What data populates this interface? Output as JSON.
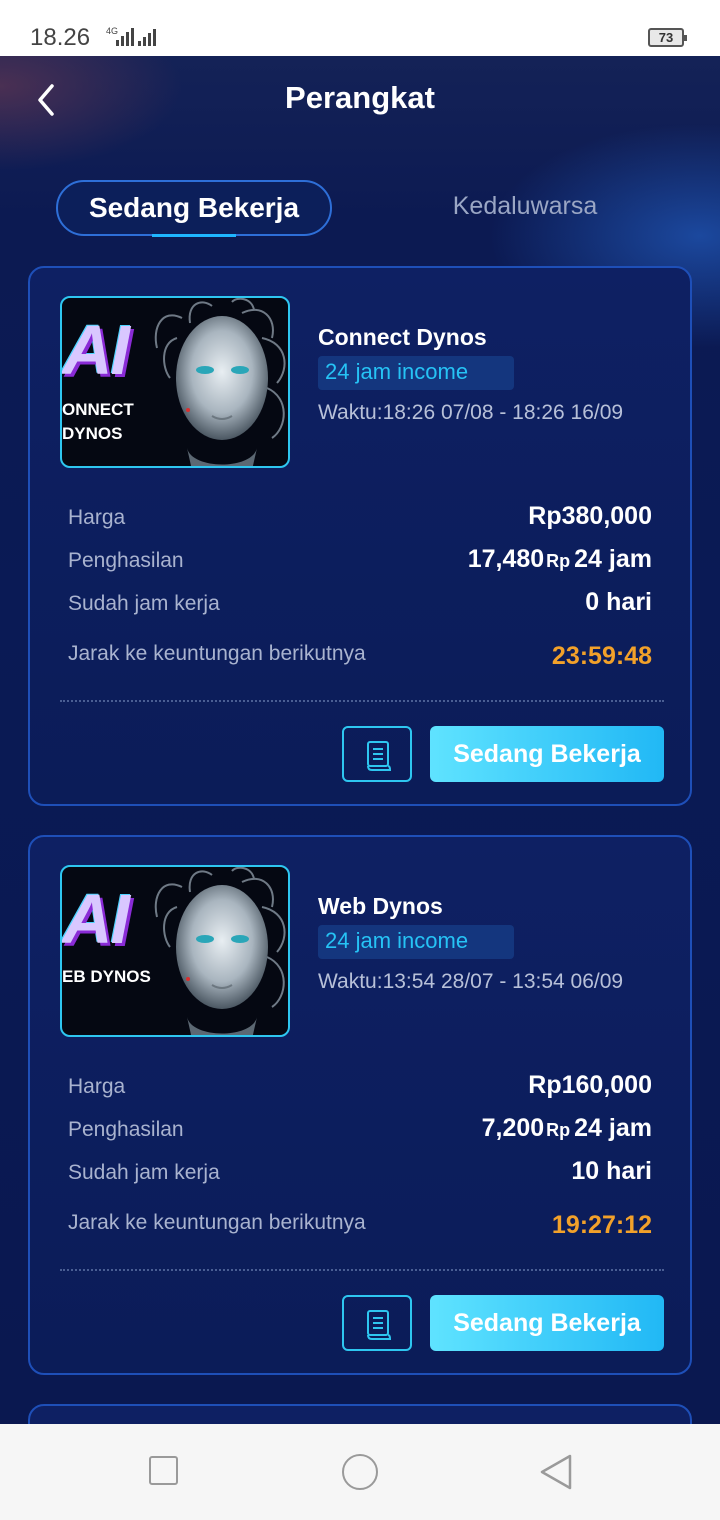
{
  "status_bar": {
    "time": "18.26",
    "network": "4G",
    "battery": "73"
  },
  "header": {
    "title": "Perangkat"
  },
  "tabs": {
    "active": "Sedang Bekerja",
    "inactive": "Kedaluwarsa"
  },
  "labels": {
    "price": "Harga",
    "income": "Penghasilan",
    "worked": "Sudah jam kerja",
    "next_profit": "Jarak ke keuntungan berikutnya",
    "currency_small": "Rp",
    "period": "24 jam",
    "days_unit": "hari"
  },
  "cards": [
    {
      "thumb_text": "AI",
      "thumb_label_line1": "ONNECT",
      "thumb_label_line2": "DYNOS",
      "name": "Connect Dynos",
      "badge": "24 jam income",
      "waktu": "Waktu:18:26 07/08 - 18:26 16/09",
      "price": "Rp380,000",
      "income_amount": "17,480",
      "worked_days": "0",
      "countdown": "23:59:48",
      "button_label": "Sedang Bekerja"
    },
    {
      "thumb_text": "AI",
      "thumb_label_line1": "EB DYNOS",
      "name": "Web Dynos",
      "badge": "24 jam income",
      "waktu": "Waktu:13:54 28/07 - 13:54 06/09",
      "price": "Rp160,000",
      "income_amount": "7,200",
      "worked_days": "10",
      "countdown": "19:27:12",
      "button_label": "Sedang Bekerja"
    }
  ],
  "icons": {
    "back": "chevron-left-icon",
    "detail": "receipt-list-icon",
    "nav_recents": "square-icon",
    "nav_home": "circle-icon",
    "nav_back": "triangle-back-icon"
  }
}
